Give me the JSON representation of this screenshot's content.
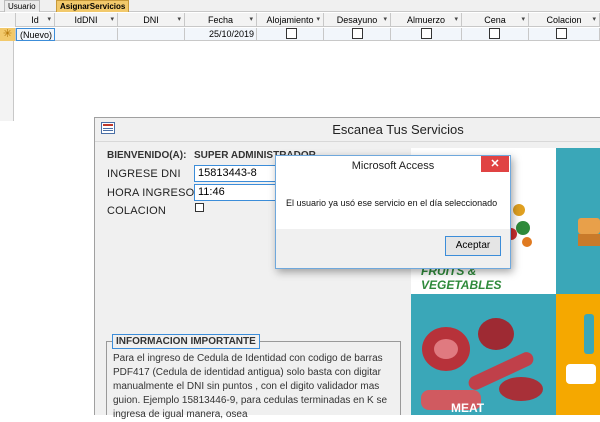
{
  "tabs": [
    {
      "label": "Usuario"
    },
    {
      "label": "AsignarServicios"
    }
  ],
  "datasheet": {
    "columns": [
      "Id",
      "IdDNI",
      "DNI",
      "Fecha",
      "Alojamiento",
      "Desayuno",
      "Almuerzo",
      "Cena",
      "Colacion"
    ],
    "new_row_marker": "✳",
    "new_row": {
      "id": "(Nuevo)",
      "fecha": "25/10/2019"
    }
  },
  "form": {
    "title": "Escanea Tus Servicios",
    "welcome_label": "BIENVENIDO(A):",
    "welcome_value": "SUPER ADMINISTRADOR",
    "dni_label": "INGRESE DNI",
    "dni_value": "15813443-8",
    "hora_label": "HORA INGRESO",
    "hora_value": "11:46",
    "colacion_label": "COLACION",
    "info_title": "INFORMACION IMPORTANTE",
    "info_text": "Para el ingreso de Cedula de Identidad con codigo de barras PDF417 (Cedula de identidad antigua) solo basta con digitar manualmente el DNI sin puntos , con el digito validador mas guion. Ejemplo 15813446-9, para cedulas terminadas en K se ingresa de igual manera, osea",
    "image_caption": "FRUITS & VEGETABLES",
    "image_caption_bottom": "MEAT"
  },
  "dialog": {
    "title": "Microsoft Access",
    "message": "El usuario ya usó ese servicio en el día seleccionado",
    "ok_label": "Aceptar",
    "close_glyph": "✕"
  },
  "colors": {
    "accent": "#3c8dd9",
    "tab_active": "#f2c96b",
    "close_red": "#e04343"
  }
}
